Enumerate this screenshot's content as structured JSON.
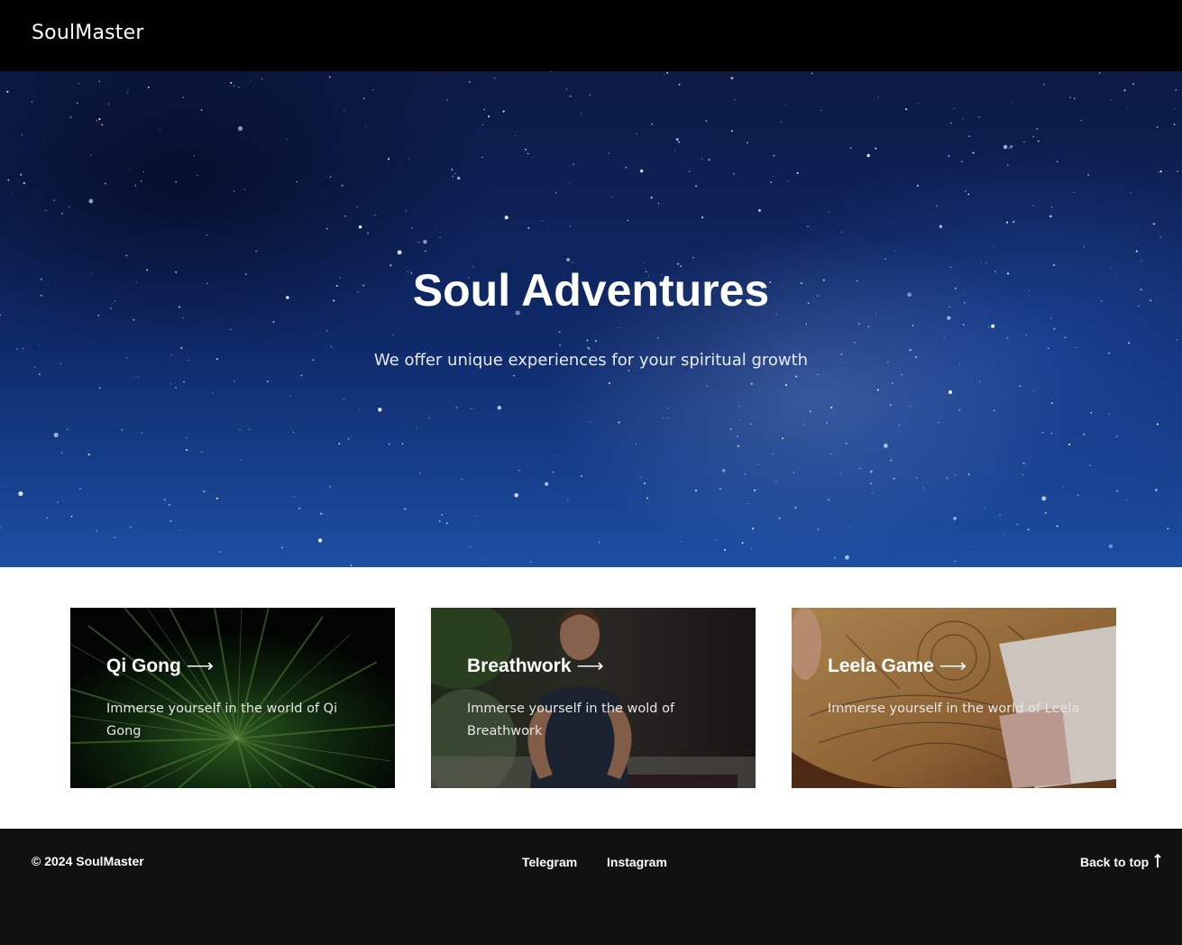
{
  "header": {
    "brand": "SoulMaster",
    "background": "#000000"
  },
  "hero": {
    "title": "Soul Adventures",
    "subtitle": "We offer unique experiences for your spiritual growth",
    "background_theme": "starry-night-sky"
  },
  "cards": [
    {
      "title": "Qi Gong",
      "arrow": "⟶",
      "description": "Immerse yourself in the world of Qi Gong",
      "image": "palm-leaf-photo"
    },
    {
      "title": "Breathwork",
      "arrow": "⟶",
      "description": "Immerse yourself in the wold of Breathwork",
      "image": "meditating-man-photo"
    },
    {
      "title": "Leela Game",
      "arrow": "⟶",
      "description": "Immerse yourself in the world of Leela",
      "image": "leela-board-game-photo"
    }
  ],
  "footer": {
    "copyright": "© 2024 SoulMaster",
    "links": [
      "Telegram",
      "Instagram"
    ],
    "back_to_top": "Back to top",
    "back_to_top_icon": "arrow-up-icon",
    "background": "#111111"
  }
}
